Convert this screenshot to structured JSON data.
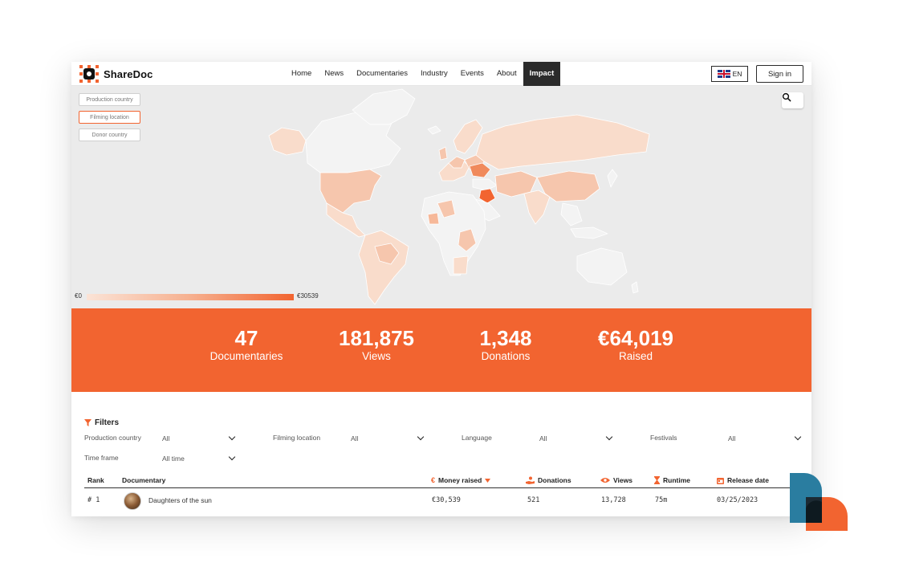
{
  "header": {
    "logo_text": "ShareDoc",
    "nav": [
      "Home",
      "News",
      "Documentaries",
      "Industry",
      "Events",
      "About",
      "Impact"
    ],
    "active_nav": "Impact",
    "language": "EN",
    "signin_label": "Sign in"
  },
  "map": {
    "toggles": [
      "Production country",
      "Filming location",
      "Donor country"
    ],
    "selected_toggle": "Filming location",
    "legend_min": "€0",
    "legend_max": "€30539",
    "colors": {
      "background": "#ebebeb",
      "no_data": "#f3f3f3",
      "low": "#f9dccb",
      "mid": "#f6b899",
      "high": "#f26430"
    }
  },
  "stats": [
    {
      "value": "47",
      "label": "Documentaries"
    },
    {
      "value": "181,875",
      "label": "Views"
    },
    {
      "value": "1,348",
      "label": "Donations"
    },
    {
      "value": "€64,019",
      "label": "Raised"
    }
  ],
  "filters": {
    "title": "Filters",
    "fields": [
      {
        "label": "Production country",
        "value": "All"
      },
      {
        "label": "Filming location",
        "value": "All"
      },
      {
        "label": "Language",
        "value": "All"
      },
      {
        "label": "Festivals",
        "value": "All"
      },
      {
        "label": "Time frame",
        "value": "All time"
      }
    ]
  },
  "table": {
    "columns": [
      "Rank",
      "Documentary",
      "Money raised",
      "Donations",
      "Views",
      "Runtime",
      "Release date"
    ],
    "rows": [
      {
        "rank": "# 1",
        "title": "Daughters of the sun",
        "money": "€30,539",
        "donations": "521",
        "views": "13,728",
        "runtime": "75m",
        "release": "03/25/2023"
      }
    ]
  },
  "accent_color": "#f26430"
}
